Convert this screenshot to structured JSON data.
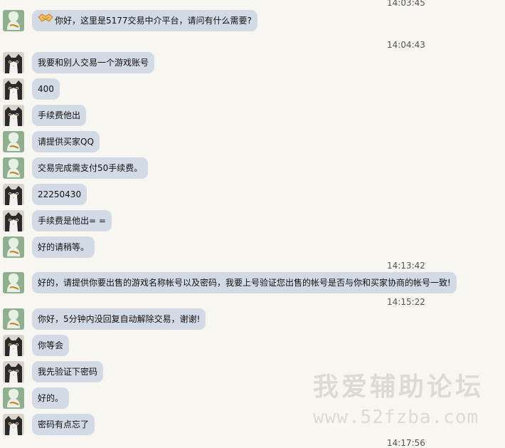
{
  "timestamps": [
    "14:03:45",
    "14:04:43",
    "14:13:42",
    "14:15:22",
    "14:17:56"
  ],
  "messages": [
    {
      "sender": "agent",
      "text": "你好，这里是5177交易中介平台，请问有什么需要?",
      "icon": "handshake-icon"
    },
    {
      "sender": "user",
      "text": "我要和别人交易一个游戏账号"
    },
    {
      "sender": "user",
      "text": "400"
    },
    {
      "sender": "user",
      "text": "手续费他出"
    },
    {
      "sender": "agent",
      "text": "请提供买家QQ"
    },
    {
      "sender": "agent",
      "text": "交易完成需支付50手续费。"
    },
    {
      "sender": "user",
      "text": "22250430"
    },
    {
      "sender": "user",
      "text": "手续费是他出= ="
    },
    {
      "sender": "agent",
      "text": "好的请稍等。"
    },
    {
      "sender": "agent",
      "text": "好的，请提供你要出售的游戏名称帐号以及密码，我要上号验证您出售的帐号是否与你和买家协商的帐号一致!"
    },
    {
      "sender": "agent",
      "text": "你好，5分钟内没回复自动解除交易，谢谢!"
    },
    {
      "sender": "user",
      "text": "你等会"
    },
    {
      "sender": "user",
      "text": "我先验证下密码"
    },
    {
      "sender": "agent",
      "text": "好的。"
    },
    {
      "sender": "user",
      "text": "密码有点忘了"
    }
  ],
  "watermark": {
    "title": "我爱辅助论坛",
    "url": "www.52fzba.com"
  },
  "colors": {
    "background": "#f7f6f1",
    "bubble": "#d2dae5",
    "agent_avatar": "#8fb08f",
    "watermark": "#dcdad4"
  }
}
